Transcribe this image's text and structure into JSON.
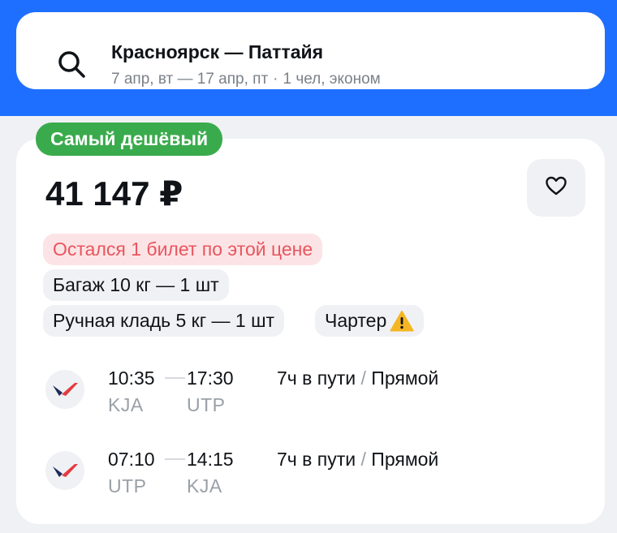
{
  "header": {
    "route": "Красноярск — Паттайя",
    "dates": "7 апр, вт — 17 апр, пт",
    "separator": "·",
    "passengers": "1 чел, эконом"
  },
  "ticket": {
    "badge": "Самый дешёвый",
    "price": "41 147 ₽",
    "tags": {
      "last_ticket": "Остался 1 билет по этой цене",
      "baggage": "Багаж 10 кг — 1 шт",
      "hand_luggage": "Ручная кладь 5 кг — 1 шт",
      "charter": "Чартер"
    },
    "segments": [
      {
        "depart_time": "10:35",
        "arrive_time": "17:30",
        "from": "KJA",
        "to": "UTP",
        "duration": "7ч в пути",
        "slash": "/",
        "type": "Прямой"
      },
      {
        "depart_time": "07:10",
        "arrive_time": "14:15",
        "from": "UTP",
        "to": "KJA",
        "duration": "7ч в пути",
        "slash": "/",
        "type": "Прямой"
      }
    ]
  },
  "icons": {
    "search": "search-icon",
    "favorite": "heart-icon",
    "warning": "warning-icon",
    "airline": "airline-logo-icon"
  },
  "colors": {
    "brand_blue": "#1e6fff",
    "badge_green": "#3aab4c",
    "warning_red": "#e9555d",
    "warning_bg": "#fce4e6",
    "airline_red": "#e53a3f",
    "airline_navy": "#1d2a5c"
  }
}
